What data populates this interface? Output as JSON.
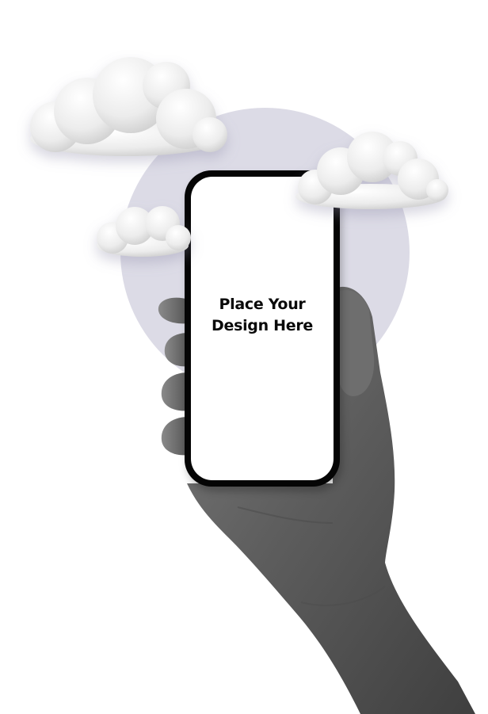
{
  "phone": {
    "screen_text": "Place Your Design Here"
  },
  "colors": {
    "background": "#ffffff",
    "circle": "#dcdbe6",
    "phone_frame": "#050505",
    "screen": "#ffffff",
    "cloud": "#ececec",
    "hand": "#5c5c5c"
  },
  "icons": [
    "cloud-icon",
    "hand-illustration",
    "phone-mockup"
  ]
}
